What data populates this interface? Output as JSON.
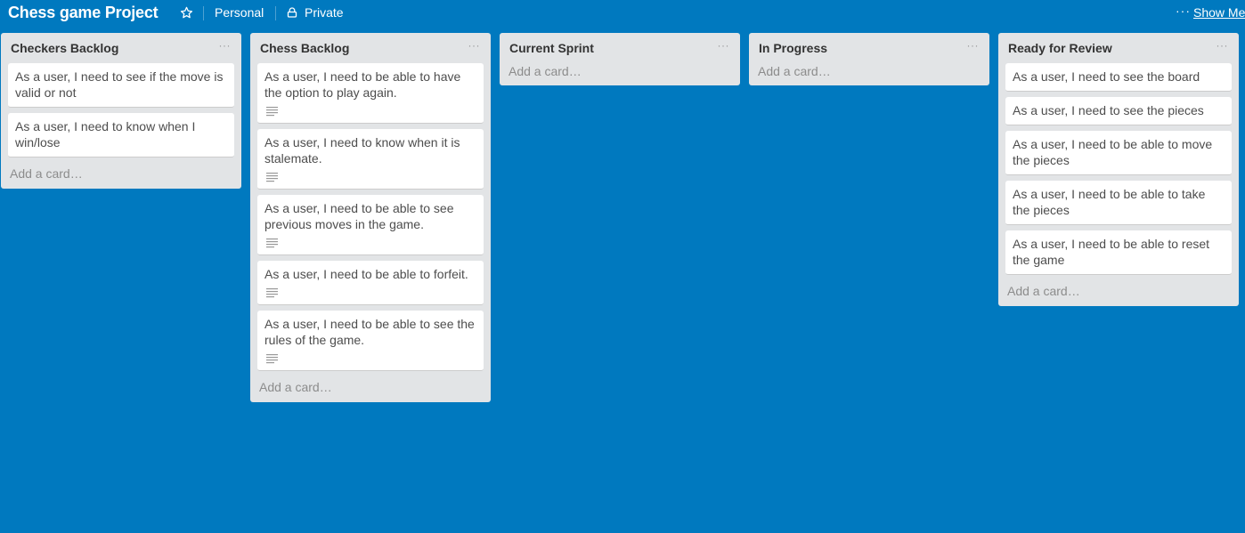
{
  "board": {
    "title": "Chess game Project",
    "team": "Personal",
    "visibility": "Private",
    "menu_dots": "···",
    "show_menu": "Show Menu"
  },
  "lists": [
    {
      "title": "Checkers Backlog",
      "menu": "···",
      "add_card": "Add a card…",
      "cards": [
        {
          "text": "As a user, I need to see if the move is valid or not"
        },
        {
          "text": "As a user, I need to know when I win/lose"
        }
      ]
    },
    {
      "title": "Chess Backlog",
      "menu": "···",
      "add_card": "Add a card…",
      "cards": [
        {
          "text": "As a user, I need to be able to have the option to play again."
        },
        {
          "text": "As a user, I need to know when it is stalemate."
        },
        {
          "text": "As a user, I need to be able to see previous moves in the game."
        },
        {
          "text": "As a user, I need to be able to forfeit."
        },
        {
          "text": "As a user, I need to be able to see the rules of the game."
        }
      ]
    },
    {
      "title": "Current Sprint",
      "menu": "···",
      "add_card": "Add a card…",
      "cards": []
    },
    {
      "title": "In Progress",
      "menu": "···",
      "add_card": "Add a card…",
      "cards": []
    },
    {
      "title": "Ready for Review",
      "menu": "···",
      "add_card": "Add a card…",
      "cards": [
        {
          "text": "As a user, I need to see the board"
        },
        {
          "text": "As a user, I need to see the pieces"
        },
        {
          "text": "As a user, I need to be able to move the pieces"
        },
        {
          "text": "As a user, I need to be able to take the pieces"
        },
        {
          "text": "As a user, I need to be able to reset the game"
        }
      ]
    }
  ]
}
